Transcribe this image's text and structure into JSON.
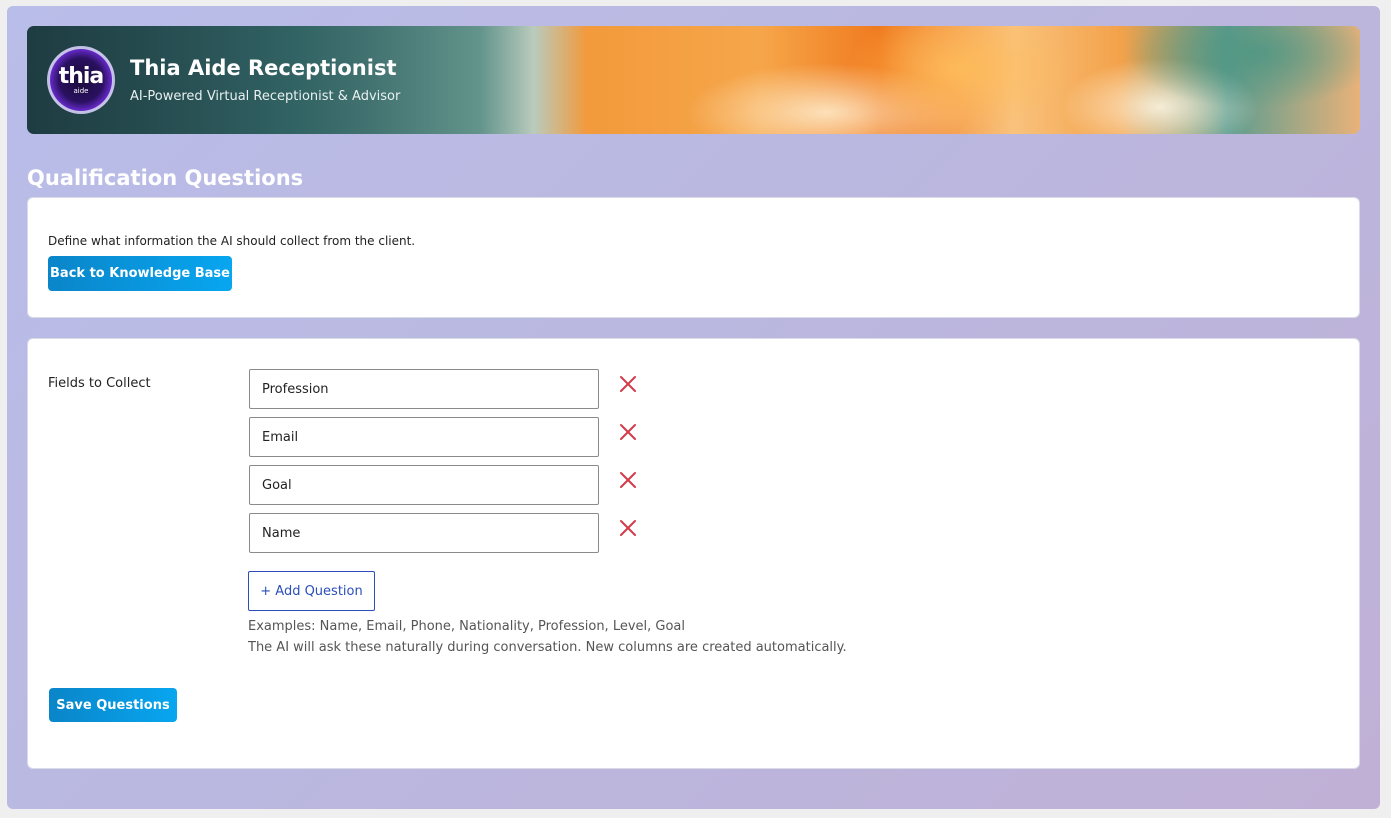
{
  "header": {
    "logo_text": "thia",
    "logo_subtext": "aide",
    "title": "Thia Aide Receptionist",
    "subtitle": "AI-Powered Virtual Receptionist & Advisor"
  },
  "page": {
    "heading": "Qualification Questions"
  },
  "intro_card": {
    "description": "Define what information the AI should collect from the client.",
    "back_button": "Back to Knowledge Base"
  },
  "fields_card": {
    "label": "Fields to Collect",
    "fields": [
      {
        "value": "Profession"
      },
      {
        "value": "Email"
      },
      {
        "value": "Goal"
      },
      {
        "value": "Name"
      }
    ],
    "add_button": "+ Add Question",
    "hint_examples": "Examples: Name, Email, Phone, Nationality, Profession, Level, Goal",
    "hint_behavior": "The AI will ask these naturally during conversation. New columns are created automatically.",
    "save_button": "Save Questions"
  },
  "colors": {
    "primary": "#0a85c9",
    "remove": "#d23b4a",
    "outline": "#2a4fb8"
  },
  "icons": {
    "remove": "close-icon"
  }
}
